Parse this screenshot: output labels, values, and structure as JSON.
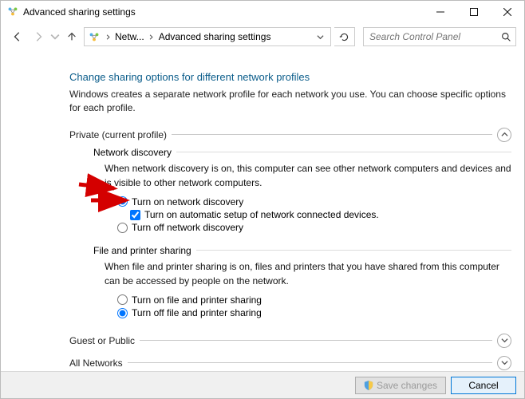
{
  "window": {
    "title": "Advanced sharing settings"
  },
  "nav": {
    "breadcrumb": {
      "seg1": "Netw...",
      "seg2": "Advanced sharing settings"
    },
    "search_placeholder": "Search Control Panel"
  },
  "page": {
    "title": "Change sharing options for different network profiles",
    "subtitle": "Windows creates a separate network profile for each network you use. You can choose specific options for each profile."
  },
  "private": {
    "label": "Private (current profile)",
    "discovery": {
      "header": "Network discovery",
      "desc": "When network discovery is on, this computer can see other network computers and devices and is visible to other network computers.",
      "opt_on": "Turn on network discovery",
      "opt_auto": "Turn on automatic setup of network connected devices.",
      "opt_off": "Turn off network discovery"
    },
    "fps": {
      "header": "File and printer sharing",
      "desc": "When file and printer sharing is on, files and printers that you have shared from this computer can be accessed by people on the network.",
      "opt_on": "Turn on file and printer sharing",
      "opt_off": "Turn off file and printer sharing"
    }
  },
  "guest": {
    "label": "Guest or Public"
  },
  "all": {
    "label": "All Networks"
  },
  "footer": {
    "save": "Save changes",
    "cancel": "Cancel"
  }
}
